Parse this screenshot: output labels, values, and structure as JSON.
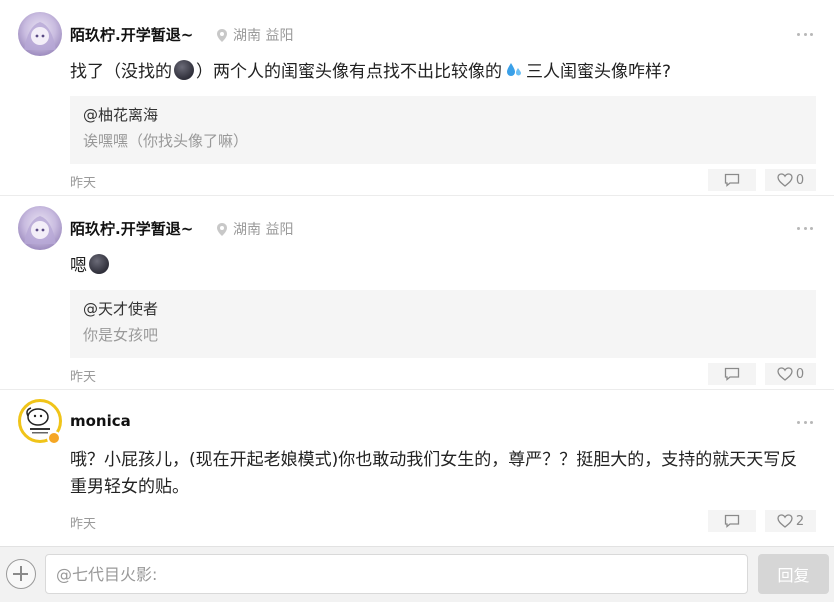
{
  "comments": [
    {
      "username": "陌玖柠.开学暂退~",
      "location": "湖南  益阳",
      "text_before": "找了（没找的",
      "text_after": "）两个人的闺蜜头像有点找不出比较像的",
      "text_tail": "三人闺蜜头像咋样?",
      "quote_user": "@柚花离海",
      "quote_text": "诶嘿嘿（你找头像了嘛）",
      "time": "昨天",
      "likes": "0"
    },
    {
      "username": "陌玖柠.开学暂退~",
      "location": "湖南  益阳",
      "text_before": "嗯",
      "quote_user": "@天才使者",
      "quote_text": "你是女孩吧",
      "time": "昨天",
      "likes": "0"
    },
    {
      "username": "monica",
      "text": "哦？小屁孩儿，(现在开起老娘模式)你也敢动我们女生的，尊严？？挺胆大的，支持的就天天写反重男轻女的贴。",
      "time": "昨天",
      "likes": "2"
    }
  ],
  "reply_bar": {
    "placeholder": "@七代目火影:",
    "submit_label": "回复"
  },
  "colors": {
    "meta_gray": "#9a9a9a",
    "quote_bg": "#f5f5f5",
    "submit_disabled": "#d6d6d6"
  }
}
